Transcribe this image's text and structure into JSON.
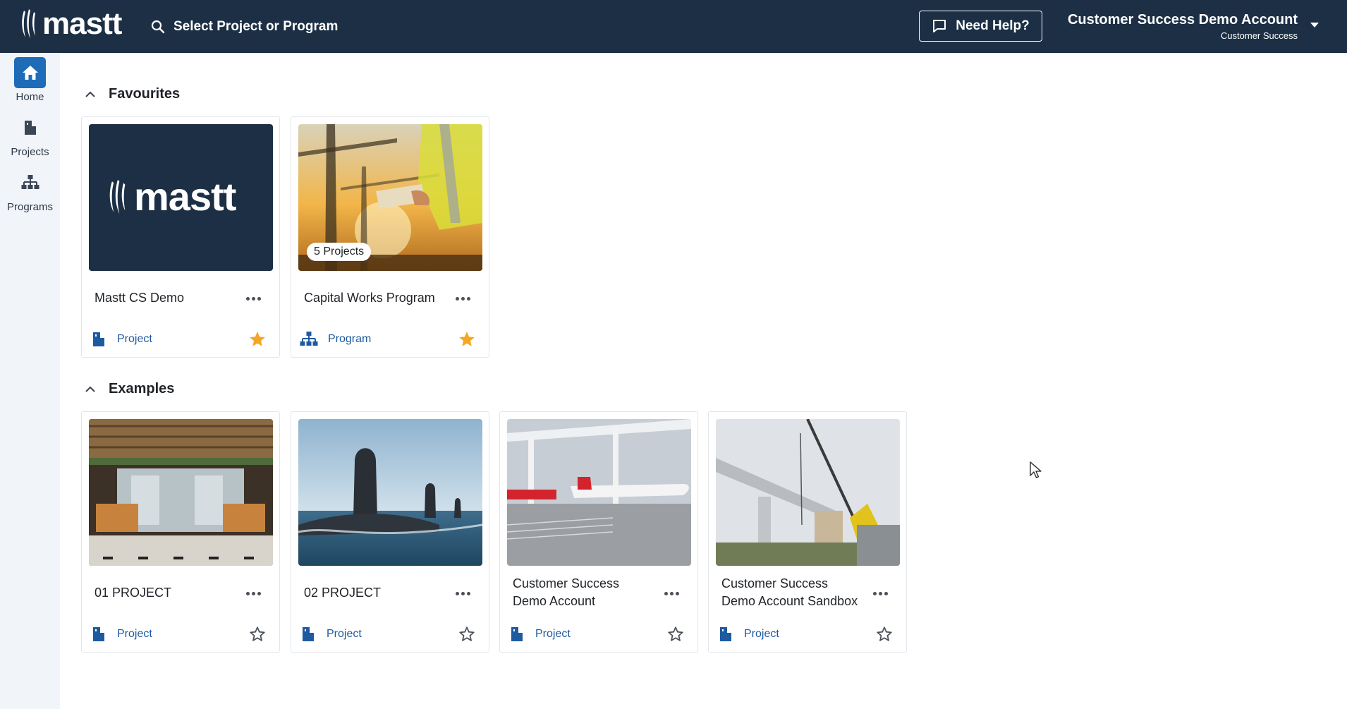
{
  "app": {
    "logo_text": "mastt"
  },
  "search": {
    "placeholder": "Select Project or Program"
  },
  "header": {
    "help_label": "Need Help?",
    "account_name": "Customer Success Demo Account",
    "account_sub": "Customer Success"
  },
  "sidebar": {
    "items": [
      {
        "label": "Home",
        "icon": "home-icon",
        "active": true
      },
      {
        "label": "Projects",
        "icon": "building-icon",
        "active": false
      },
      {
        "label": "Programs",
        "icon": "hierarchy-icon",
        "active": false
      }
    ]
  },
  "sections": {
    "favourites": {
      "title": "Favourites",
      "cards": [
        {
          "title": "Mastt CS Demo",
          "type": "Project",
          "starred": true,
          "thumb_text": "mastt"
        },
        {
          "title": "Capital Works Program",
          "type": "Program",
          "starred": true,
          "badge": "5 Projects"
        }
      ]
    },
    "examples": {
      "title": "Examples",
      "cards": [
        {
          "title": "01 PROJECT",
          "type": "Project",
          "starred": false
        },
        {
          "title": "02 PROJECT",
          "type": "Project",
          "starred": false
        },
        {
          "title": "Customer Success Demo Account",
          "type": "Project",
          "starred": false
        },
        {
          "title": "Customer Success Demo Account Sandbox",
          "type": "Project",
          "starred": false
        }
      ]
    }
  },
  "colors": {
    "header_bg": "#1c2f45",
    "sidebar_bg": "#f1f4f8",
    "accent": "#1e6bb8",
    "link": "#1e5aa0",
    "star_filled": "#f5a623"
  }
}
